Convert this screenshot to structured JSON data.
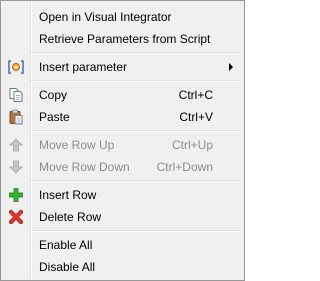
{
  "menu": {
    "items": [
      {
        "label": "Open in Visual Integrator",
        "shortcut": "",
        "disabled": false,
        "icon": ""
      },
      {
        "label": "Retrieve Parameters from Script",
        "shortcut": "",
        "disabled": false,
        "icon": ""
      },
      {
        "label": "Insert parameter",
        "shortcut": "",
        "disabled": false,
        "icon": "parameter-icon",
        "submenu": true
      },
      {
        "label": "Copy",
        "shortcut": "Ctrl+C",
        "disabled": false,
        "icon": "copy-icon"
      },
      {
        "label": "Paste",
        "shortcut": "Ctrl+V",
        "disabled": false,
        "icon": "paste-icon"
      },
      {
        "label": "Move Row Up",
        "shortcut": "Ctrl+Up",
        "disabled": true,
        "icon": "arrow-up-icon"
      },
      {
        "label": "Move Row Down",
        "shortcut": "Ctrl+Down",
        "disabled": true,
        "icon": "arrow-down-icon"
      },
      {
        "label": "Insert Row",
        "shortcut": "",
        "disabled": false,
        "icon": "plus-icon"
      },
      {
        "label": "Delete Row",
        "shortcut": "",
        "disabled": false,
        "icon": "delete-icon"
      },
      {
        "label": "Enable All",
        "shortcut": "",
        "disabled": false,
        "icon": ""
      },
      {
        "label": "Disable All",
        "shortcut": "",
        "disabled": false,
        "icon": ""
      }
    ]
  },
  "colors": {
    "background": "#f0f0f0",
    "border": "#979797",
    "disabled_text": "#8d8d8d",
    "plus_green": "#2fa52f",
    "delete_red": "#d9342b",
    "arrow_gray": "#b5b5b5"
  }
}
